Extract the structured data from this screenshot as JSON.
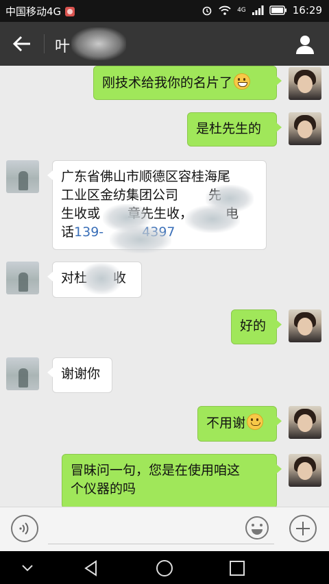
{
  "status_bar": {
    "carrier": "中国移动4G",
    "network": "4G",
    "time": "16:29"
  },
  "header": {
    "title": "叶"
  },
  "messages": [
    {
      "side": "me",
      "text": "刚技术给我你的名片了"
    },
    {
      "side": "me",
      "text": "是杜先生的"
    },
    {
      "side": "other",
      "lines": [
        "广东省佛山市顺德区容桂海尾",
        "工业区金纺集团公司",
        "生收或",
        "章先生收，",
        "电",
        "话",
        "139-",
        "4397"
      ]
    },
    {
      "side": "other",
      "text_start": "对杜",
      "text_end": "收"
    },
    {
      "side": "me",
      "text": "好的"
    },
    {
      "side": "other",
      "text": "谢谢你"
    },
    {
      "side": "me",
      "text": "不用谢"
    },
    {
      "side": "me",
      "lines": [
        "冒昧问一句，您是在使用咱这",
        "个仪器的吗"
      ]
    }
  ],
  "colors": {
    "me_bubble": "#a0e75a",
    "other_bubble": "#ffffff",
    "titlebar": "#363636",
    "link": "#3a6fb8"
  },
  "icons": {
    "back": "arrow-left-icon",
    "profile": "person-icon",
    "voice": "voice-icon",
    "emoji": "emoji-icon",
    "add": "plus-icon"
  }
}
